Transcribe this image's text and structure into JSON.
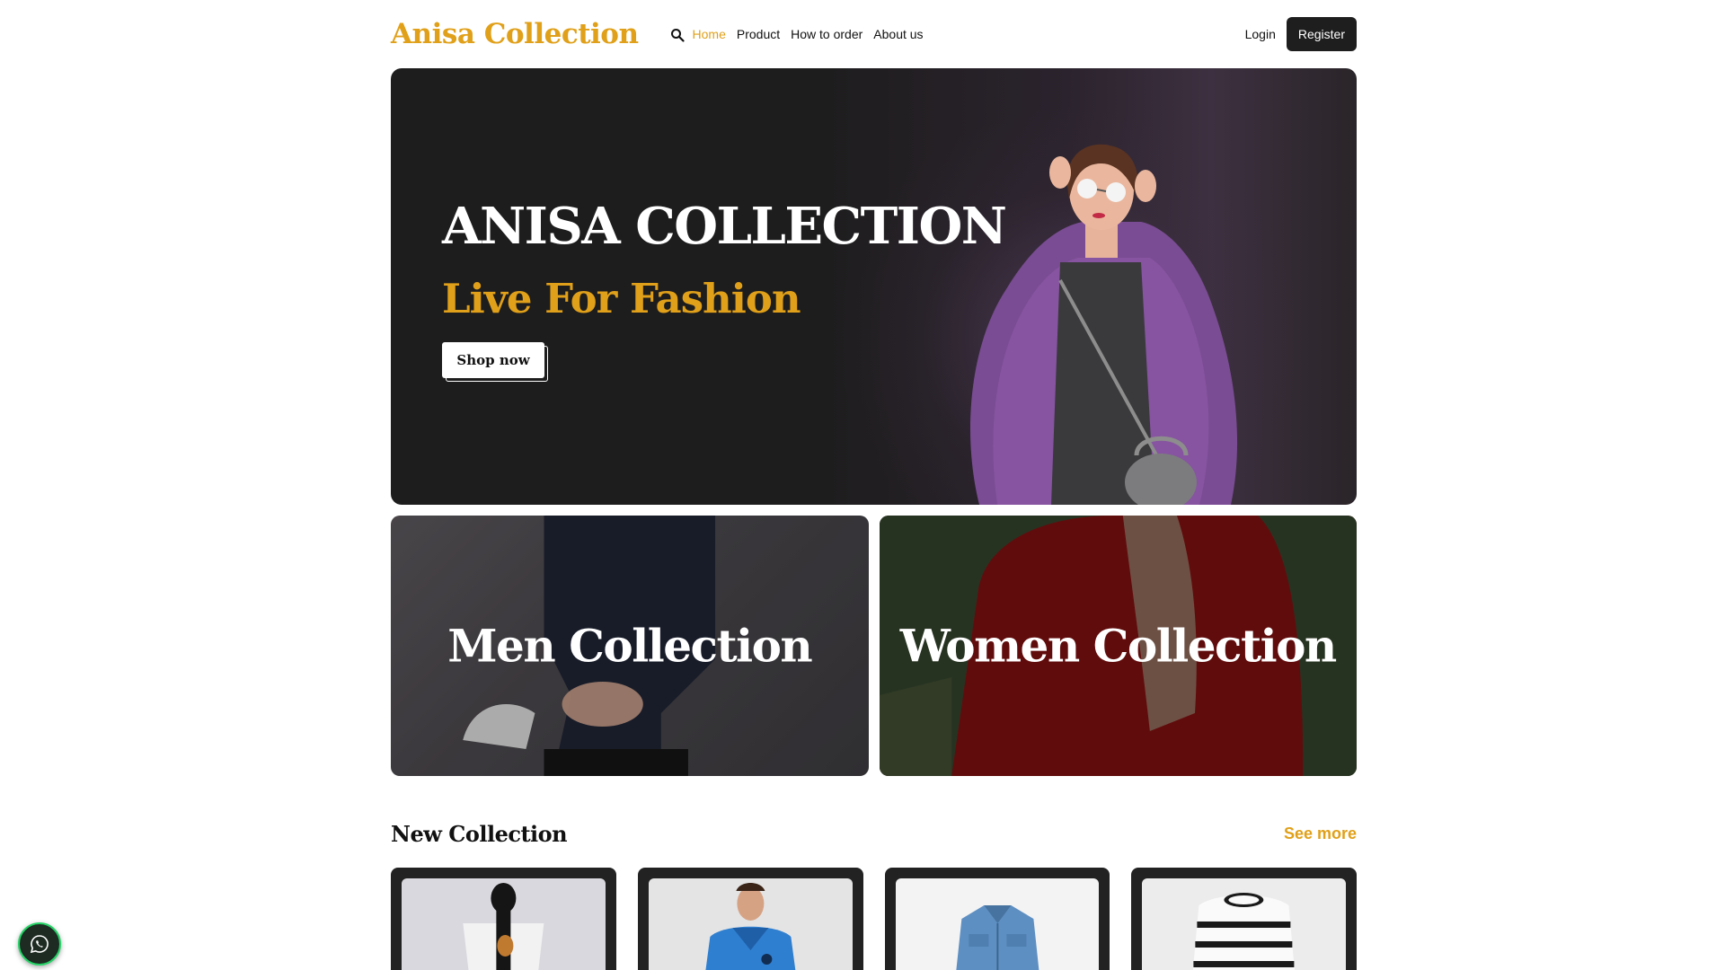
{
  "brand": "Anisa Collection",
  "nav": {
    "items": [
      {
        "label": "Home",
        "active": true
      },
      {
        "label": "Product",
        "active": false
      },
      {
        "label": "How to order",
        "active": false
      },
      {
        "label": "About us",
        "active": false
      }
    ],
    "login_label": "Login",
    "register_label": "Register",
    "search_icon": "search-icon"
  },
  "hero": {
    "title": "ANISA COLLECTION",
    "subtitle": "Live For Fashion",
    "cta_label": "Shop now"
  },
  "collections": [
    {
      "label": "Men Collection"
    },
    {
      "label": "Women Collection"
    }
  ],
  "new_collection": {
    "title": "New Collection",
    "see_more_label": "See more",
    "products": [
      {
        "image": "hijab-tshirt-model"
      },
      {
        "image": "blue-jacket-model"
      },
      {
        "image": "denim-shirt"
      },
      {
        "image": "striped-sweater"
      }
    ]
  },
  "colors": {
    "accent": "#e0a019",
    "dark": "#1e1e1e",
    "whatsapp": "#25d366"
  },
  "floating": {
    "icon": "whatsapp-icon"
  }
}
